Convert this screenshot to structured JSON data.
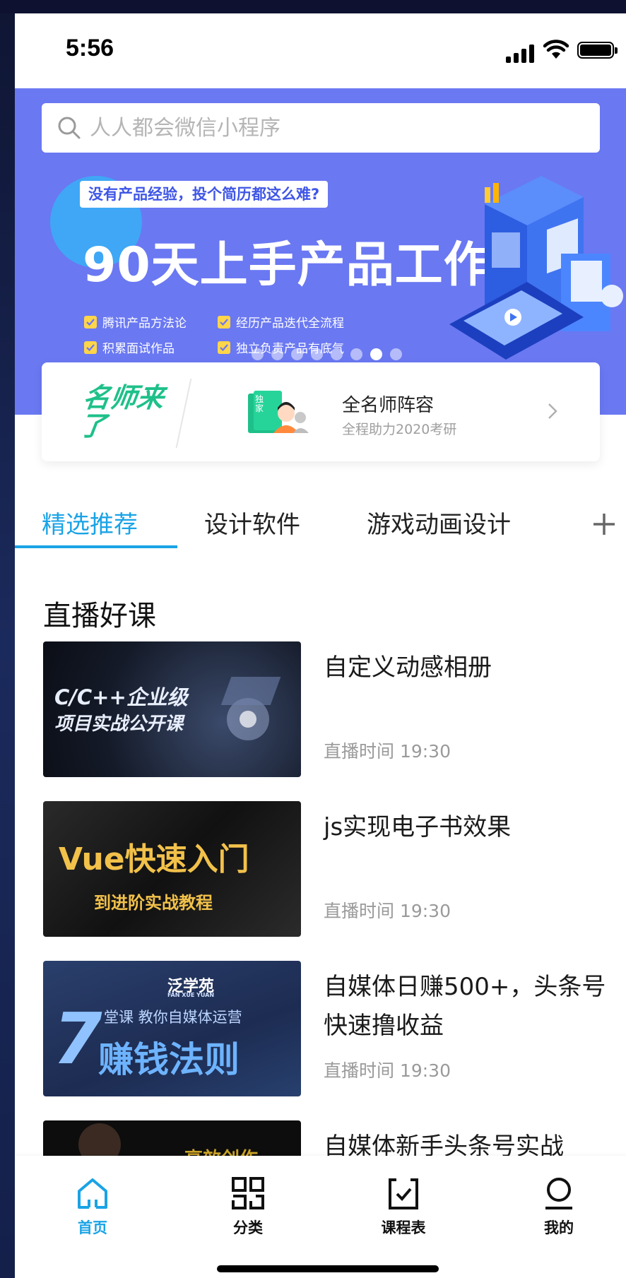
{
  "status_bar": {
    "time": "5:56"
  },
  "search": {
    "placeholder": "人人都会微信小程序"
  },
  "banner": {
    "tag": "没有产品经验，投个简历都这么难?",
    "title": "90天上手产品工作",
    "features": [
      "腾讯产品方法论",
      "经历产品迭代全流程",
      "积累面试作品",
      "独立负责产品有底气"
    ],
    "dot_count": 8,
    "active_dot": 7
  },
  "teacher_card": {
    "badge": "名师来了",
    "illus_tag": "独家",
    "title": "全名师阵容",
    "subtitle": "全程助力2020考研"
  },
  "tabs": [
    {
      "label": "精选推荐",
      "active": true
    },
    {
      "label": "设计软件",
      "active": false
    },
    {
      "label": "游戏动画设计",
      "active": false
    }
  ],
  "section_title": "直播好课",
  "courses": [
    {
      "title": "自定义动感相册",
      "time": "直播时间 19:30",
      "thumb_text": [
        "C/C++企业级",
        "项目实战公开课"
      ]
    },
    {
      "title": "js实现电子书效果",
      "time": "直播时间 19:30",
      "thumb_text": [
        "Vue快速入门",
        "到进阶实战教程"
      ]
    },
    {
      "title": "自媒体日赚500+，头条号快速撸收益",
      "time": "直播时间 19:30",
      "thumb_text": [
        "泛学苑",
        "FAN XUE YUAN",
        "7",
        "堂课  教你自媒体运营",
        "赚钱法则"
      ]
    },
    {
      "title": "自媒体新手头条号实战",
      "time": "",
      "thumb_text": [
        "高效创作"
      ]
    }
  ],
  "bottom_nav": [
    {
      "label": "首页",
      "icon": "home-icon",
      "active": true
    },
    {
      "label": "分类",
      "icon": "grid-icon",
      "active": false
    },
    {
      "label": "课程表",
      "icon": "schedule-icon",
      "active": false
    },
    {
      "label": "我的",
      "icon": "profile-icon",
      "active": false
    }
  ],
  "colors": {
    "accent": "#1aa3e6",
    "banner_bg": "#6a78f2",
    "teacher_green": "#1ec089"
  }
}
